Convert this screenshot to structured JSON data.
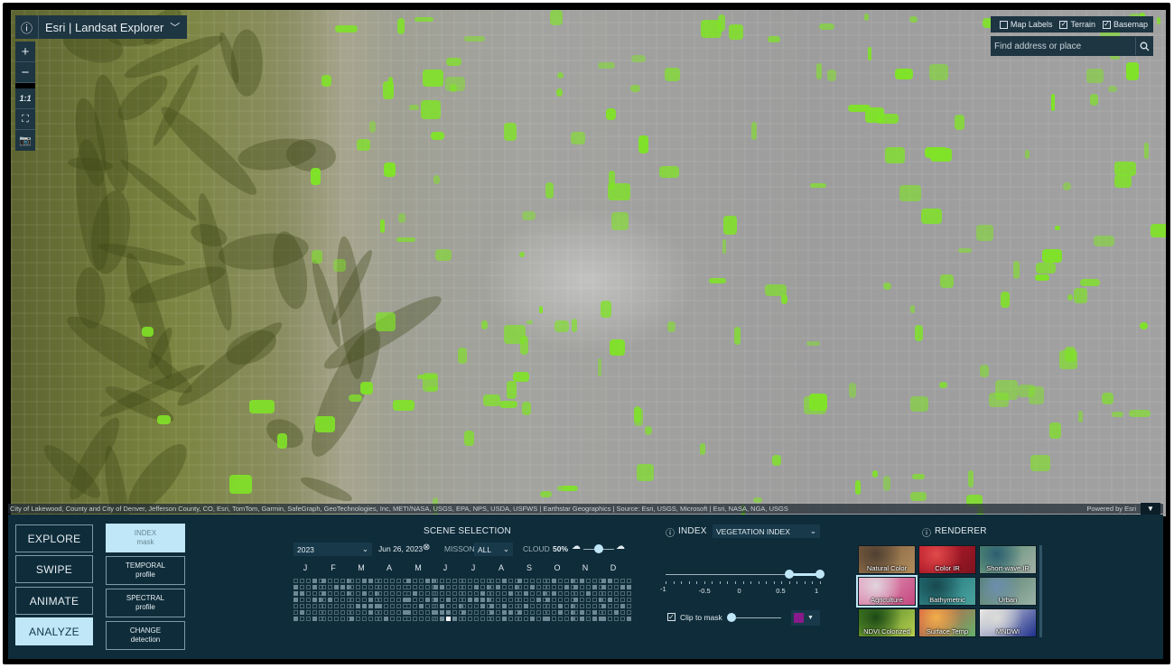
{
  "app": {
    "title": "Esri | Landsat Explorer"
  },
  "map_tools": {
    "zoom_in": "+",
    "zoom_out": "−",
    "scale_label": "1:1"
  },
  "layers": {
    "map_labels": "Map Labels",
    "map_labels_checked": false,
    "terrain": "Terrain",
    "terrain_checked": true,
    "basemap": "Basemap",
    "basemap_checked": true
  },
  "search": {
    "placeholder": "Find address or place"
  },
  "attribution": {
    "text": "City of Lakewood, County and City of Denver, Jefferson County, CO, Esri, TomTom, Garmin, SafeGraph, GeoTechnologies, Inc, METI/NASA, USGS, EPA, NPS, USDA, USFWS | Earthstar Geographics | Source: Esri, USGS, Microsoft | Esri, NASA, NGA, USGS",
    "powered": "Powered by Esri"
  },
  "modes": {
    "explore": "EXPLORE",
    "swipe": "SWIPE",
    "animate": "ANIMATE",
    "analyze": "ANALYZE",
    "active": "ANALYZE"
  },
  "analyze_tools": [
    {
      "line1": "INDEX",
      "line2": "mask",
      "active": true
    },
    {
      "line1": "TEMPORAL",
      "line2": "profile",
      "active": false
    },
    {
      "line1": "SPECTRAL",
      "line2": "profile",
      "active": false
    },
    {
      "line1": "CHANGE",
      "line2": "detection",
      "active": false
    }
  ],
  "scene_selection": {
    "title": "SCENE SELECTION",
    "year": "2023",
    "date": "Jun 26, 2023",
    "mission_label": "MISSON",
    "mission_value": "ALL",
    "cloud_label": "CLOUD",
    "cloud_value": "50%",
    "months": [
      "J",
      "F",
      "M",
      "A",
      "M",
      "J",
      "J",
      "A",
      "S",
      "O",
      "N",
      "D"
    ]
  },
  "index": {
    "title": "INDEX",
    "selected": "VEGETATION INDEX",
    "ticks": [
      "-1",
      "-0.5",
      "0",
      "0.5",
      "1"
    ],
    "range": [
      0.6,
      1
    ],
    "clip_label": "Clip to mask",
    "clip_checked": true,
    "mask_color": "#8a1a8c"
  },
  "renderer": {
    "title": "RENDERER",
    "selected": "Agriculture",
    "tiles": [
      {
        "label": "Natural Color",
        "colors": [
          "#7a5a3c",
          "#b08c5c",
          "#4f4032"
        ]
      },
      {
        "label": "Color IR",
        "colors": [
          "#c1192a",
          "#7e1420",
          "#e04a4a"
        ]
      },
      {
        "label": "Short-wave IR",
        "colors": [
          "#4c8a6a",
          "#a4b0a8",
          "#2b5f72"
        ]
      },
      {
        "label": "Agriculture",
        "colors": [
          "#e8a4c4",
          "#c4487e",
          "#e0d4dc"
        ]
      },
      {
        "label": "Bathymetric",
        "colors": [
          "#1d6d73",
          "#4aa39f",
          "#18484e"
        ]
      },
      {
        "label": "Urban",
        "colors": [
          "#4d7a62",
          "#9bb2a8",
          "#6c8fae"
        ]
      },
      {
        "label": "NDVI Colorized",
        "colors": [
          "#3f7a1f",
          "#b8cf52",
          "#1b4a15"
        ]
      },
      {
        "label": "Surface Temp",
        "colors": [
          "#d84c3f",
          "#63b26d",
          "#f2ae4a"
        ]
      },
      {
        "label": "MNDWI",
        "colors": [
          "#f2f1ed",
          "#1d2f8c",
          "#dcdcd8"
        ]
      }
    ]
  }
}
